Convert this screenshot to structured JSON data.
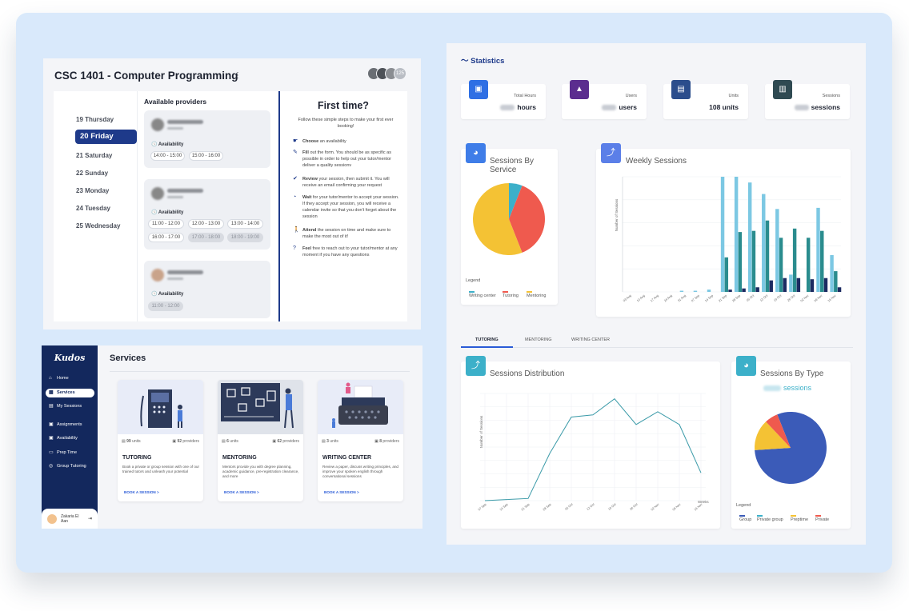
{
  "booking": {
    "course_title": "CSC 1401 - Computer Programming",
    "member_count": "125",
    "days": [
      "19 Thursday",
      "20 Friday",
      "21 Saturday",
      "22 Sunday",
      "23 Monday",
      "24 Tuesday",
      "25 Wednesday"
    ],
    "active_day": "20 Friday",
    "providers_heading": "Available providers",
    "availability_label": "Availability",
    "providers": [
      {
        "slots": [
          "14:00 - 15:00",
          "15:00 - 16:00"
        ],
        "disabled": []
      },
      {
        "slots": [
          "11:00 - 12:00",
          "12:00 - 13:00",
          "13:00 - 14:00",
          "16:00 - 17:00",
          "17:00 - 18:00",
          "18:00 - 19:00"
        ],
        "disabled": [
          "17:00 - 18:00",
          "18:00 - 19:00"
        ]
      },
      {
        "slots": [
          "11:00 - 12:00"
        ],
        "disabled": [
          "11:00 - 12:00"
        ]
      }
    ],
    "first_time": {
      "title": "First time?",
      "subtitle": "Follow these simple steps to make your first ever booking!",
      "steps": [
        {
          "icon": "pointing-hand-icon",
          "bold": "Choose",
          "text": " an availability"
        },
        {
          "icon": "pencil-icon",
          "bold": "Fill",
          "text": " out the form. You should be as specific as possible in order to help out your tutor/mentor deliver a quality sessionv"
        },
        {
          "icon": "check-circle-icon",
          "bold": "Review",
          "text": " your session, then submit it. You will receive an email confirming your request"
        },
        {
          "icon": "clock-icon",
          "bold": "Wait",
          "text": " for your tutor/mentor to accept your session. If they accept your session, you will receive a calendar invite so that you don't forget about the session"
        },
        {
          "icon": "walking-person-icon",
          "bold": "Attend",
          "text": " the session on time and make sure to make the most out of it!"
        },
        {
          "icon": "help-icon",
          "bold": "Feel",
          "text": " free to reach out to your tutor/mentor at any moment if you have any questions"
        }
      ]
    }
  },
  "kudos": {
    "logo": "Kudos",
    "nav": [
      {
        "icon": "home-icon",
        "label": "Home"
      },
      {
        "icon": "grid-icon",
        "label": "Services"
      },
      {
        "icon": "calendar-icon",
        "label": "My Sessions"
      },
      {
        "icon": "clipboard-icon",
        "label": "Assignments"
      },
      {
        "icon": "calendar-check-icon",
        "label": "Availability"
      },
      {
        "icon": "monitor-icon",
        "label": "Prep Time"
      },
      {
        "icon": "group-icon",
        "label": "Group Tutoring"
      }
    ],
    "active_nav": "Services",
    "user_name": "Zakaria El Aan",
    "services_title": "Services",
    "services": [
      {
        "units": "99",
        "units_label": "units",
        "providers": "92",
        "providers_label": "providers",
        "title": "TUTORING",
        "desc": "Book a private or group session with one of our trained tutors and unleash your potential",
        "cta": "BOOK A SESSION  >"
      },
      {
        "units": "6",
        "units_label": "units",
        "providers": "62",
        "providers_label": "providers",
        "title": "MENTORING",
        "desc": "Mentors provide you with degree planning, academic guidance, pre-registration clearance, and more",
        "cta": "BOOK A SESSION  >"
      },
      {
        "units": "3",
        "units_label": "units",
        "providers": "8",
        "providers_label": "providers",
        "title": "WRITING CENTER",
        "desc": "Review a paper, discuss writing principles, and improve your spoken english through conversational sessions",
        "cta": "BOOK A SESSION  >"
      }
    ]
  },
  "stats": {
    "title": "Statistics",
    "kpis": [
      {
        "label": "Total Hours",
        "unit": "hours",
        "color": "#2f6fe4",
        "icon": "briefcase-icon"
      },
      {
        "label": "Users",
        "unit": "users",
        "color": "#5b2d8f",
        "icon": "user-icon"
      },
      {
        "label": "Units",
        "value": "108 units",
        "color": "#2b4d8c",
        "icon": "library-icon"
      },
      {
        "label": "Sessions",
        "unit": "sessions",
        "color": "#2f4a52",
        "icon": "bar-chart-icon"
      }
    ],
    "sessions_by_service_title": "Sessions By Service",
    "weekly_sessions_title": "Weekly Sessions",
    "weekly_ylabel": "Number of Sessions",
    "legend_label": "Legend",
    "service_legend": [
      {
        "name": "Writing center",
        "color": "#3cb0c9"
      },
      {
        "name": "Tutoring",
        "color": "#ef5a4e"
      },
      {
        "name": "Mentoring",
        "color": "#f4c234"
      }
    ],
    "tabs": [
      "TUTORING",
      "MENTORING",
      "WRITING CENTER"
    ],
    "active_tab": "TUTORING",
    "distribution_title": "Sessions Distribution",
    "distribution_ylabel": "Number of Sessions",
    "distribution_xlabel": "Weeks",
    "by_type_title": "Sessions By Type",
    "by_type_subtitle": "sessions",
    "type_legend": [
      {
        "name": "Group",
        "color": "#3b5bb8"
      },
      {
        "name": "Private group",
        "color": "#3cb0c9"
      },
      {
        "name": "Preptime",
        "color": "#f4c234"
      },
      {
        "name": "Private",
        "color": "#ef5a4e"
      }
    ]
  },
  "chart_data": [
    {
      "type": "pie",
      "title": "Sessions By Service",
      "labels": [
        "Writing center",
        "Tutoring",
        "Mentoring"
      ],
      "values": [
        6,
        38,
        56
      ],
      "colors": [
        "#3cb0c9",
        "#ef5a4e",
        "#f4c234"
      ]
    },
    {
      "type": "bar",
      "title": "Weekly Sessions",
      "ylabel": "Number of Sessions",
      "categories": [
        "03 Aug",
        "10 Aug",
        "17 Aug",
        "24 Aug",
        "31 Aug",
        "07 Sep",
        "14 Sep",
        "21 Sep",
        "28 Sep",
        "05 Oct",
        "12 Oct",
        "19 Oct",
        "26 Oct",
        "02 Nov",
        "09 Nov",
        "16 Nov"
      ],
      "series": [
        {
          "values": [
            0,
            0,
            0,
            0,
            1,
            1,
            2,
            100,
            100,
            95,
            85,
            72,
            15,
            0,
            73,
            32
          ],
          "color": "#7cc8e3"
        },
        {
          "values": [
            0,
            0,
            0,
            0,
            0,
            0,
            0,
            30,
            52,
            53,
            62,
            47,
            55,
            47,
            53,
            18
          ],
          "color": "#2a8c8e"
        },
        {
          "values": [
            0,
            0,
            0,
            0,
            0,
            0,
            0,
            2,
            3,
            4,
            10,
            12,
            12,
            11,
            12,
            4
          ],
          "color": "#1c2b62"
        }
      ],
      "ylim": [
        0,
        100
      ]
    },
    {
      "type": "line",
      "title": "Sessions Distribution",
      "ylabel": "Number of Sessions",
      "xlabel": "Weeks",
      "categories": [
        "07 Sep",
        "14 Sep",
        "21 Sep",
        "28 Sep",
        "05 Oct",
        "12 Oct",
        "19 Oct",
        "26 Oct",
        "02 Nov",
        "09 Nov",
        "16 Nov"
      ],
      "values": [
        0,
        1,
        2,
        44,
        78,
        80,
        95,
        71,
        83,
        71,
        26
      ],
      "ylim": [
        0,
        100
      ]
    },
    {
      "type": "pie",
      "title": "Sessions By Type",
      "labels": [
        "Group",
        "Private group",
        "Preptime",
        "Private"
      ],
      "values": [
        80,
        0,
        14,
        6
      ],
      "colors": [
        "#3b5bb8",
        "#3cb0c9",
        "#f4c234",
        "#ef5a4e"
      ]
    }
  ]
}
